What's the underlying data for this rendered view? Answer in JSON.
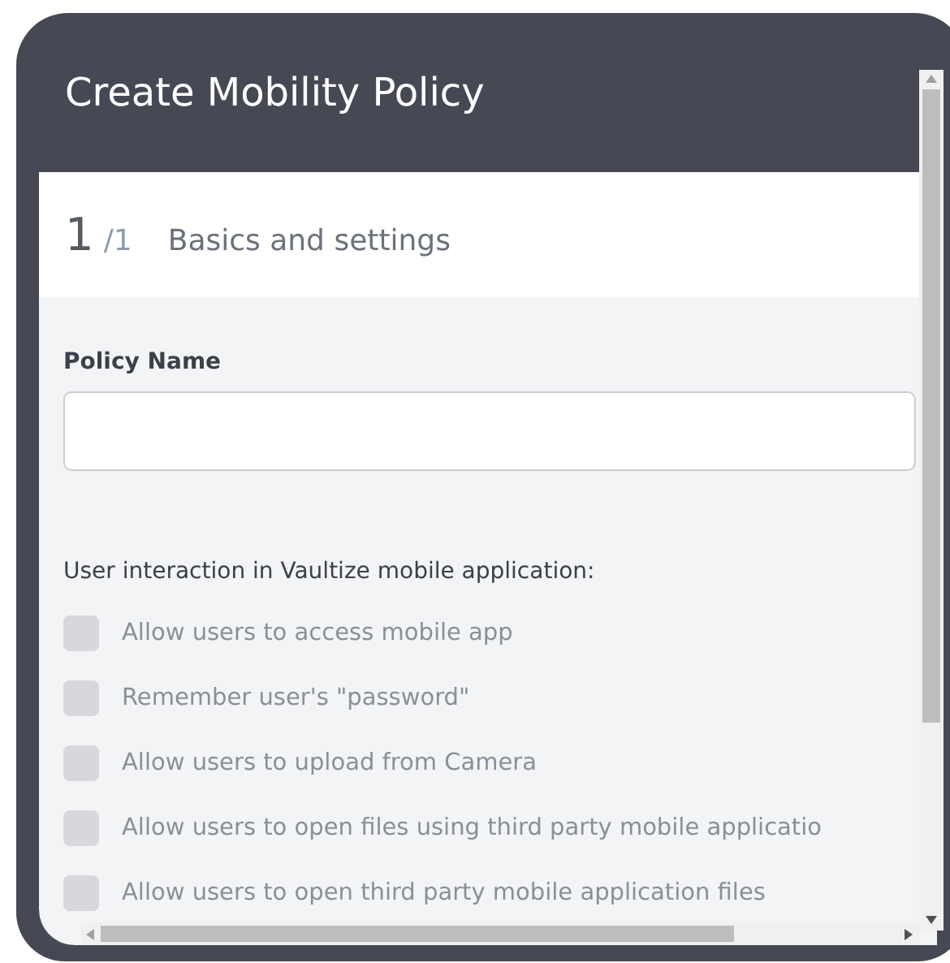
{
  "dialog": {
    "title": "Create Mobility Policy"
  },
  "step": {
    "current": "1",
    "total": "/1",
    "title": "Basics and settings"
  },
  "policy_name": {
    "label": "Policy Name"
  },
  "permissions": {
    "heading": "User interaction in Vaultize mobile application:",
    "options": [
      {
        "label": "Allow users to access mobile app",
        "checked": false
      },
      {
        "label": "Remember user's \"password\"",
        "checked": false
      },
      {
        "label": "Allow users to upload from Camera",
        "checked": false
      },
      {
        "label": "Allow users to open files using third party mobile applicatio",
        "checked": false
      },
      {
        "label": "Allow users to open third party mobile application files",
        "checked": false
      }
    ]
  }
}
